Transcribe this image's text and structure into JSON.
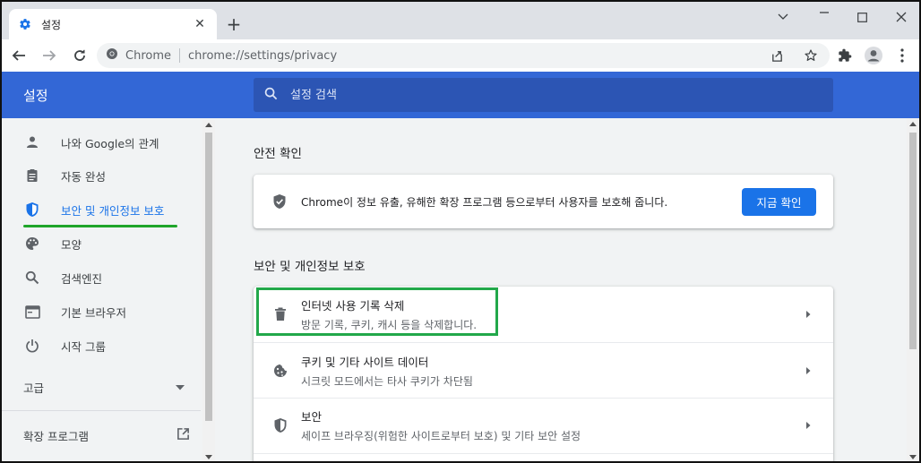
{
  "tab": {
    "title": "설정",
    "close": "✕"
  },
  "newtab": "+",
  "window_controls": {
    "minimize": "﹀",
    "maximize": "☐",
    "close": "✕"
  },
  "address": {
    "site_label": "Chrome",
    "url": "chrome://settings/privacy"
  },
  "header": {
    "title": "설정",
    "search_placeholder": "설정 검색"
  },
  "sidebar": {
    "items": [
      {
        "label": "나와 Google의 관계",
        "icon": "person-icon"
      },
      {
        "label": "자동 완성",
        "icon": "clipboard-icon"
      },
      {
        "label": "보안 및 개인정보 보호",
        "icon": "shield-icon",
        "active": true
      },
      {
        "label": "모양",
        "icon": "palette-icon"
      },
      {
        "label": "검색엔진",
        "icon": "search-icon"
      },
      {
        "label": "기본 브라우저",
        "icon": "browser-icon"
      },
      {
        "label": "시작 그룹",
        "icon": "power-icon"
      }
    ],
    "advanced": "고급",
    "extensions": "확장 프로그램"
  },
  "main": {
    "safety_title": "안전 확인",
    "safety_text": "Chrome이 정보 유출, 유해한 확장 프로그램 등으로부터 사용자를 보호해 줍니다.",
    "safety_button": "지금 확인",
    "privacy_title": "보안 및 개인정보 보호",
    "rows": [
      {
        "title": "인터넷 사용 기록 삭제",
        "subtitle": "방문 기록, 쿠키, 캐시 등을 삭제합니다.",
        "icon": "trash-icon"
      },
      {
        "title": "쿠키 및 기타 사이트 데이터",
        "subtitle": "시크릿 모드에서는 타사 쿠키가 차단됨",
        "icon": "cookie-icon"
      },
      {
        "title": "보안",
        "subtitle": "세이프 브라우징(위험한 사이트로부터 보호) 및 기타 보안 설정",
        "icon": "shield-icon"
      }
    ]
  },
  "colors": {
    "accent": "#1a73e8",
    "header": "#3367d6",
    "highlight": "#22a84a"
  }
}
